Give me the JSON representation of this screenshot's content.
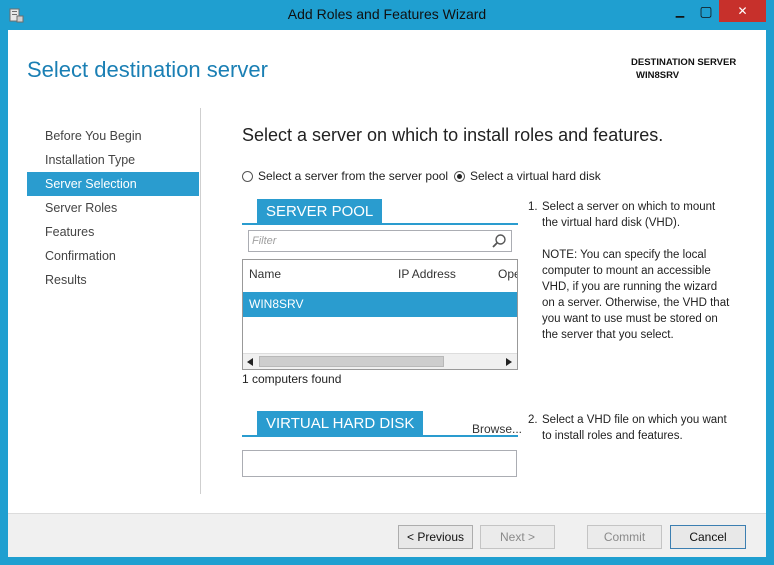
{
  "window": {
    "title": "Add Roles and Features Wizard",
    "min_glyph": "▁",
    "max_glyph": "▢",
    "close_glyph": "✕",
    "accent": "#1f9fd0",
    "close_color": "#c7302b"
  },
  "header": {
    "page_title": "Select destination server",
    "destination_label": "DESTINATION SERVER",
    "destination_value": "WIN8SRV"
  },
  "nav": {
    "items": [
      {
        "label": "Before You Begin",
        "selected": false
      },
      {
        "label": "Installation Type",
        "selected": false
      },
      {
        "label": "Server Selection",
        "selected": true
      },
      {
        "label": "Server Roles",
        "selected": false
      },
      {
        "label": "Features",
        "selected": false
      },
      {
        "label": "Confirmation",
        "selected": false
      },
      {
        "label": "Results",
        "selected": false
      }
    ]
  },
  "main": {
    "heading": "Select a server on which to install roles and features.",
    "options": [
      {
        "label": "Select a server from the server pool",
        "checked": false
      },
      {
        "label": "Select a virtual hard disk",
        "checked": true
      }
    ],
    "server_pool": {
      "title": "SERVER POOL",
      "filter_placeholder": "Filter",
      "columns": [
        "Name",
        "IP Address",
        "Ope"
      ],
      "rows": [
        {
          "name": "WIN8SRV",
          "selected": true
        }
      ],
      "found_text": "1 computers found",
      "search_icon": "search-icon"
    },
    "vhd": {
      "title": "VIRTUAL HARD DISK",
      "browse_label": "Browse...",
      "path_value": ""
    },
    "steps": [
      {
        "number": "1.",
        "text": "Select a server on which to mount the virtual hard disk (VHD)."
      },
      {
        "number": "",
        "text": "NOTE: You can specify the local computer to mount an accessible VHD, if you are running the wizard on a server. Otherwise, the VHD that you want to use must be stored on the server that you select."
      },
      {
        "number": "2.",
        "text": "Select a VHD file on which you want to install roles and features."
      }
    ]
  },
  "footer": {
    "previous_label": "< Previous",
    "next_label": "Next >",
    "commit_label": "Commit",
    "cancel_label": "Cancel"
  }
}
